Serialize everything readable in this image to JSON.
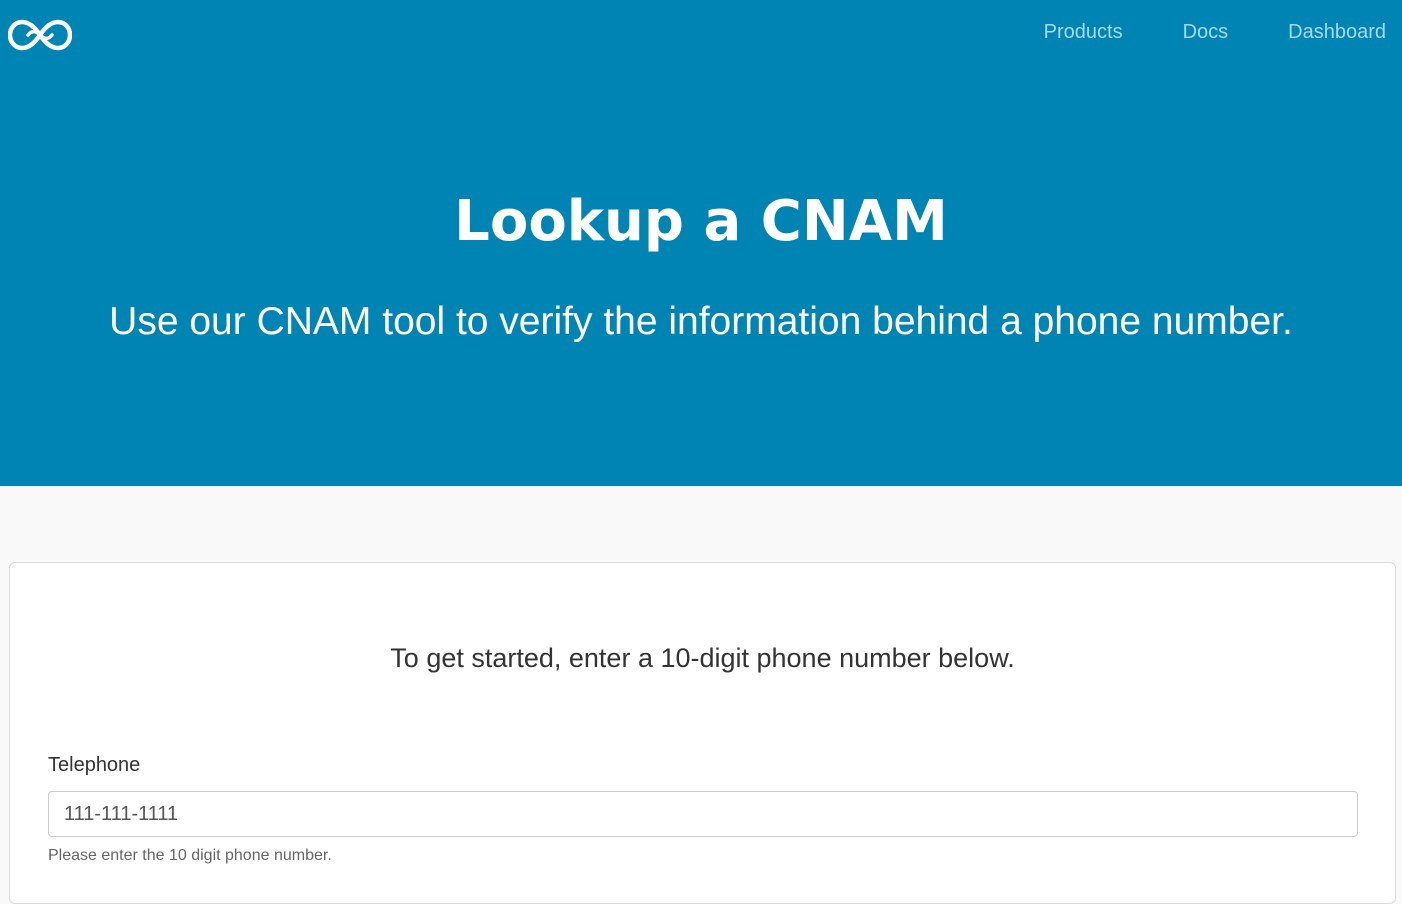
{
  "header": {
    "logo_icon": "infinity-logo-icon",
    "nav": [
      {
        "label": "Products"
      },
      {
        "label": "Docs"
      },
      {
        "label": "Dashboard"
      }
    ]
  },
  "hero": {
    "title": "Lookup a CNAM",
    "subtitle": "Use our CNAM tool to verify the information behind a phone number."
  },
  "form": {
    "intro": "To get started, enter a 10-digit phone number below.",
    "telephone_label": "Telephone",
    "telephone_placeholder": "111-111-1111",
    "telephone_value": "",
    "telephone_help": "Please enter the 10 digit phone number."
  },
  "colors": {
    "hero_background": "#0084b4",
    "nav_link": "#a8d8ee",
    "page_background": "#f9f9f9"
  }
}
